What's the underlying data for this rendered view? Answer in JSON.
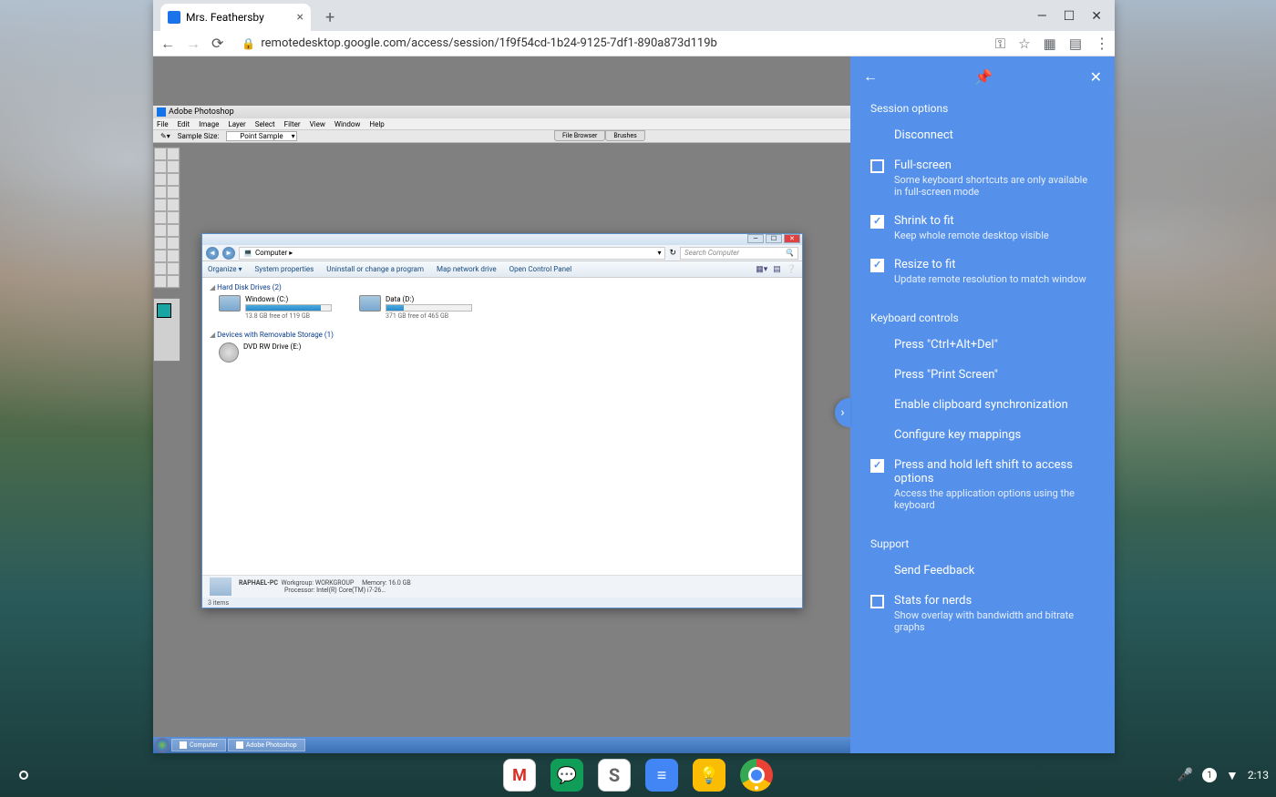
{
  "browser": {
    "tab": {
      "title": "Mrs. Feathersby"
    },
    "url": "remotedesktop.google.com/access/session/1f9f54cd-1b24-9125-7df1-890a873d119b"
  },
  "photoshop": {
    "title": "Adobe Photoshop",
    "menu": [
      "File",
      "Edit",
      "Image",
      "Layer",
      "Select",
      "Filter",
      "View",
      "Window",
      "Help"
    ],
    "sample_label": "Sample Size:",
    "sample_value": "Point Sample",
    "tabs": [
      "File Browser",
      "Brushes"
    ]
  },
  "explorer": {
    "path_icon": "💻",
    "path": "Computer ▸",
    "search_placeholder": "Search Computer",
    "toolbar": [
      "Organize ▾",
      "System properties",
      "Uninstall or change a program",
      "Map network drive",
      "Open Control Panel"
    ],
    "hdd_section": "Hard Disk Drives (2)",
    "drives": [
      {
        "name": "Windows (C:)",
        "free": "13.8 GB free of 119 GB",
        "fill_pct": 88
      },
      {
        "name": "Data (D:)",
        "free": "371 GB free of 465 GB",
        "fill_pct": 20
      }
    ],
    "removable_section": "Devices with Removable Storage (1)",
    "dvd": "DVD RW Drive (E:)",
    "status": {
      "pc": "RAPHAEL-PC",
      "workgroup_label": "Workgroup:",
      "workgroup": "WORKGROUP",
      "memory_label": "Memory:",
      "memory": "16.0 GB",
      "processor_label": "Processor:",
      "processor": "Intel(R) Core(TM) i7-26…"
    },
    "items_count": "3 items"
  },
  "taskbar": {
    "items": [
      "Computer",
      "Adobe Photoshop"
    ]
  },
  "panel": {
    "session_title": "Session options",
    "disconnect": "Disconnect",
    "fullscreen": {
      "label": "Full-screen",
      "desc": "Some keyboard shortcuts are only available in full-screen mode"
    },
    "shrink": {
      "label": "Shrink to fit",
      "desc": "Keep whole remote desktop visible"
    },
    "resize": {
      "label": "Resize to fit",
      "desc": "Update remote resolution to match window"
    },
    "keyboard_title": "Keyboard controls",
    "ctrlaltdel": "Press \"Ctrl+Alt+Del\"",
    "printscreen": "Press \"Print Screen\"",
    "clipboard": "Enable clipboard synchronization",
    "keymap": "Configure key mappings",
    "leftshift": {
      "label": "Press and hold left shift to access options",
      "desc": "Access the application options using the keyboard"
    },
    "support_title": "Support",
    "feedback": "Send Feedback",
    "stats": {
      "label": "Stats for nerds",
      "desc": "Show overlay with bandwidth and bitrate graphs"
    }
  },
  "shelf": {
    "time": "2:13",
    "notification_count": "1"
  }
}
